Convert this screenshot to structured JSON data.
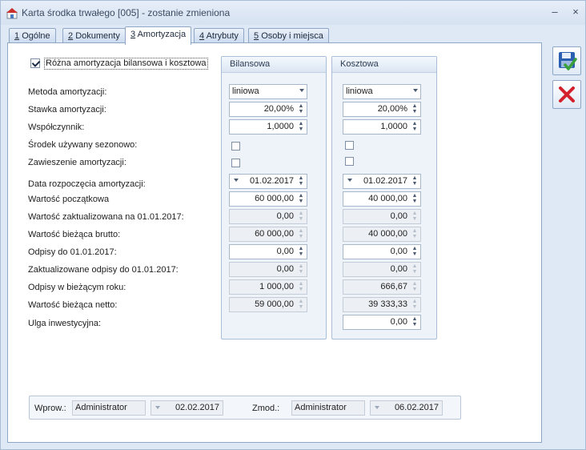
{
  "window": {
    "title": "Karta środka trwałego [005] - zostanie zmieniona",
    "minimize_glyph": "–",
    "close_glyph": "×"
  },
  "tabs": [
    {
      "num": "1",
      "label": "Ogólne"
    },
    {
      "num": "2",
      "label": "Dokumenty"
    },
    {
      "num": "3",
      "label": "Amortyzacja"
    },
    {
      "num": "4",
      "label": "Atrybuty"
    },
    {
      "num": "5",
      "label": "Osoby i miejsca"
    }
  ],
  "active_tab": 2,
  "different_amortization": {
    "label": "Różna amortyzacja bilansowa i kosztowa",
    "checked": true
  },
  "columns": {
    "bilansowa": "Bilansowa",
    "kosztowa": "Kosztowa"
  },
  "labels": {
    "metoda": "Metoda amortyzacji:",
    "stawka": "Stawka amortyzacji:",
    "wspolczynnik": "Współczynnik:",
    "sezonowo": "Środek używany sezonowo:",
    "zawieszenie": "Zawieszenie amortyzacji:",
    "data_rozpoczecia": "Data rozpoczęcia amortyzacji:",
    "wartosc_poczatkowa": "Wartość początkowa",
    "wartosc_zaktualizowana": "Wartość zaktualizowana na 01.01.2017:",
    "wartosc_biezaca_brutto": "Wartość bieżąca brutto:",
    "odpisy_do": "Odpisy do 01.01.2017:",
    "zakt_odpisy": "Zaktualizowane odpisy do 01.01.2017:",
    "odpisy_biezacy": "Odpisy w bieżącym roku:",
    "wartosc_netto": "Wartość bieżąca netto:",
    "ulga": "Ulga inwestycyjna:"
  },
  "bilansowa": {
    "metoda": "liniowa",
    "stawka": "20,00%",
    "wspolczynnik": "1,0000",
    "data_rozpoczecia": "01.02.2017",
    "wartosc_poczatkowa": "60 000,00",
    "wartosc_zaktualizowana": "0,00",
    "wartosc_biezaca_brutto": "60 000,00",
    "odpisy_do": "0,00",
    "zakt_odpisy": "0,00",
    "odpisy_biezacy": "1 000,00",
    "wartosc_netto": "59 000,00"
  },
  "kosztowa": {
    "metoda": "liniowa",
    "stawka": "20,00%",
    "wspolczynnik": "1,0000",
    "data_rozpoczecia": "01.02.2017",
    "wartosc_poczatkowa": "40 000,00",
    "wartosc_zaktualizowana": "0,00",
    "wartosc_biezaca_brutto": "40 000,00",
    "odpisy_do": "0,00",
    "zakt_odpisy": "0,00",
    "odpisy_biezacy": "666,67",
    "wartosc_netto": "39 333,33",
    "ulga": "0,00"
  },
  "footer": {
    "wprow_label": "Wprow.:",
    "wprow_user": "Administrator",
    "wprow_date": "02.02.2017",
    "zmod_label": "Zmod.:",
    "zmod_user": "Administrator",
    "zmod_date": "06.02.2017"
  },
  "icons": {
    "save": "save-icon",
    "cancel": "cancel-icon"
  },
  "colors": {
    "cancel_red": "#d3202a",
    "save_blue": "#2b5fb0",
    "save_green": "#3aa03a"
  }
}
